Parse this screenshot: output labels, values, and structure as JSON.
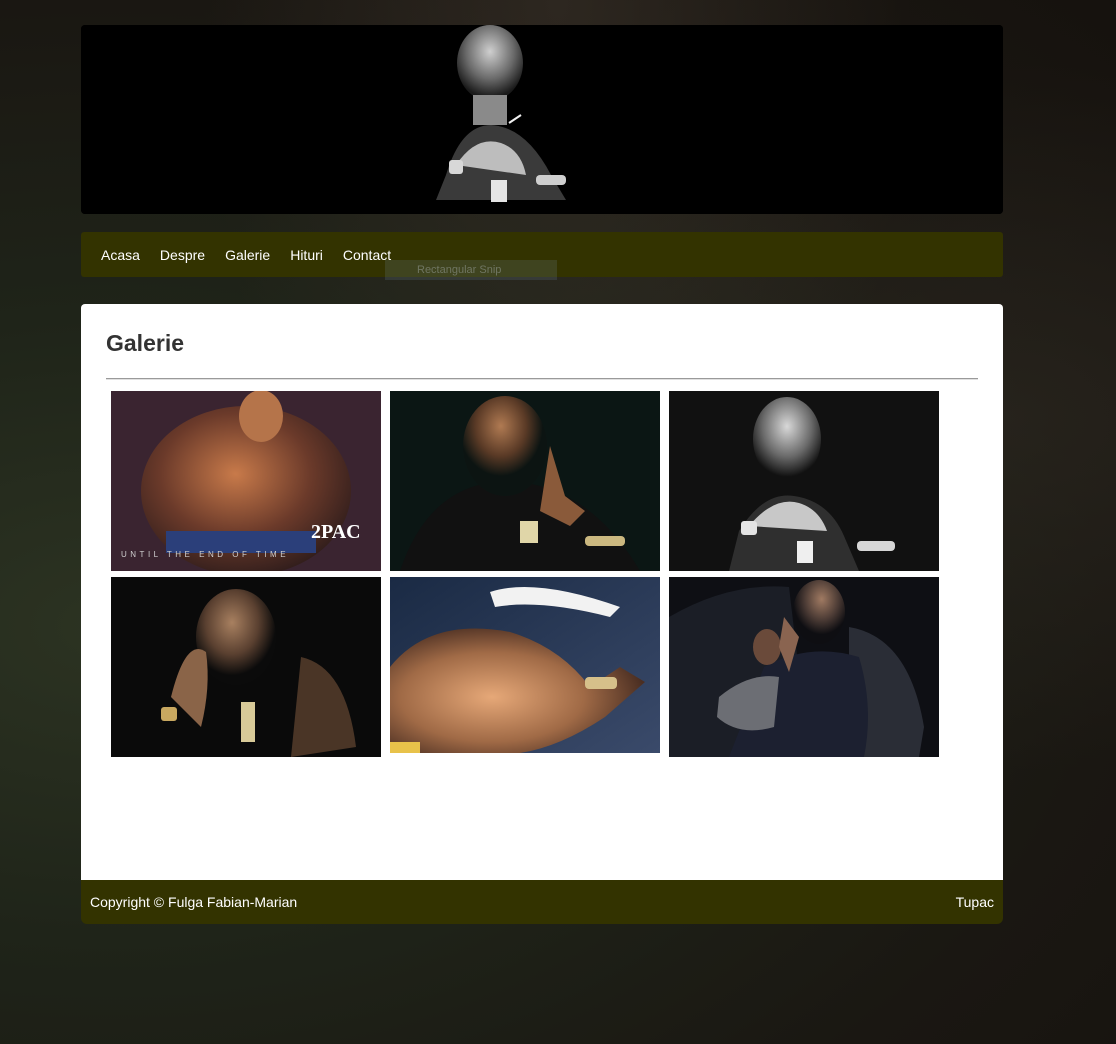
{
  "nav": {
    "items": [
      "Acasa",
      "Despre",
      "Galerie",
      "Hituri",
      "Contact"
    ]
  },
  "overlay": {
    "snip_label": "Rectangular Snip"
  },
  "content": {
    "title": "Galerie"
  },
  "gallery": {
    "captions": [
      "2PAC",
      "UNTIL THE END OF TIME"
    ]
  },
  "footer": {
    "copyright": "Copyright © Fulga Fabian-Marian",
    "right": "Tupac"
  },
  "colors": {
    "nav_bg": "#333300",
    "footer_bg": "#333300",
    "content_bg": "#ffffff",
    "title": "#333333"
  },
  "icons": {
    "header_image": "portrait-photo",
    "thumbs": [
      "portrait-photo",
      "portrait-photo",
      "portrait-photo",
      "portrait-photo",
      "portrait-photo",
      "portrait-photo"
    ]
  }
}
